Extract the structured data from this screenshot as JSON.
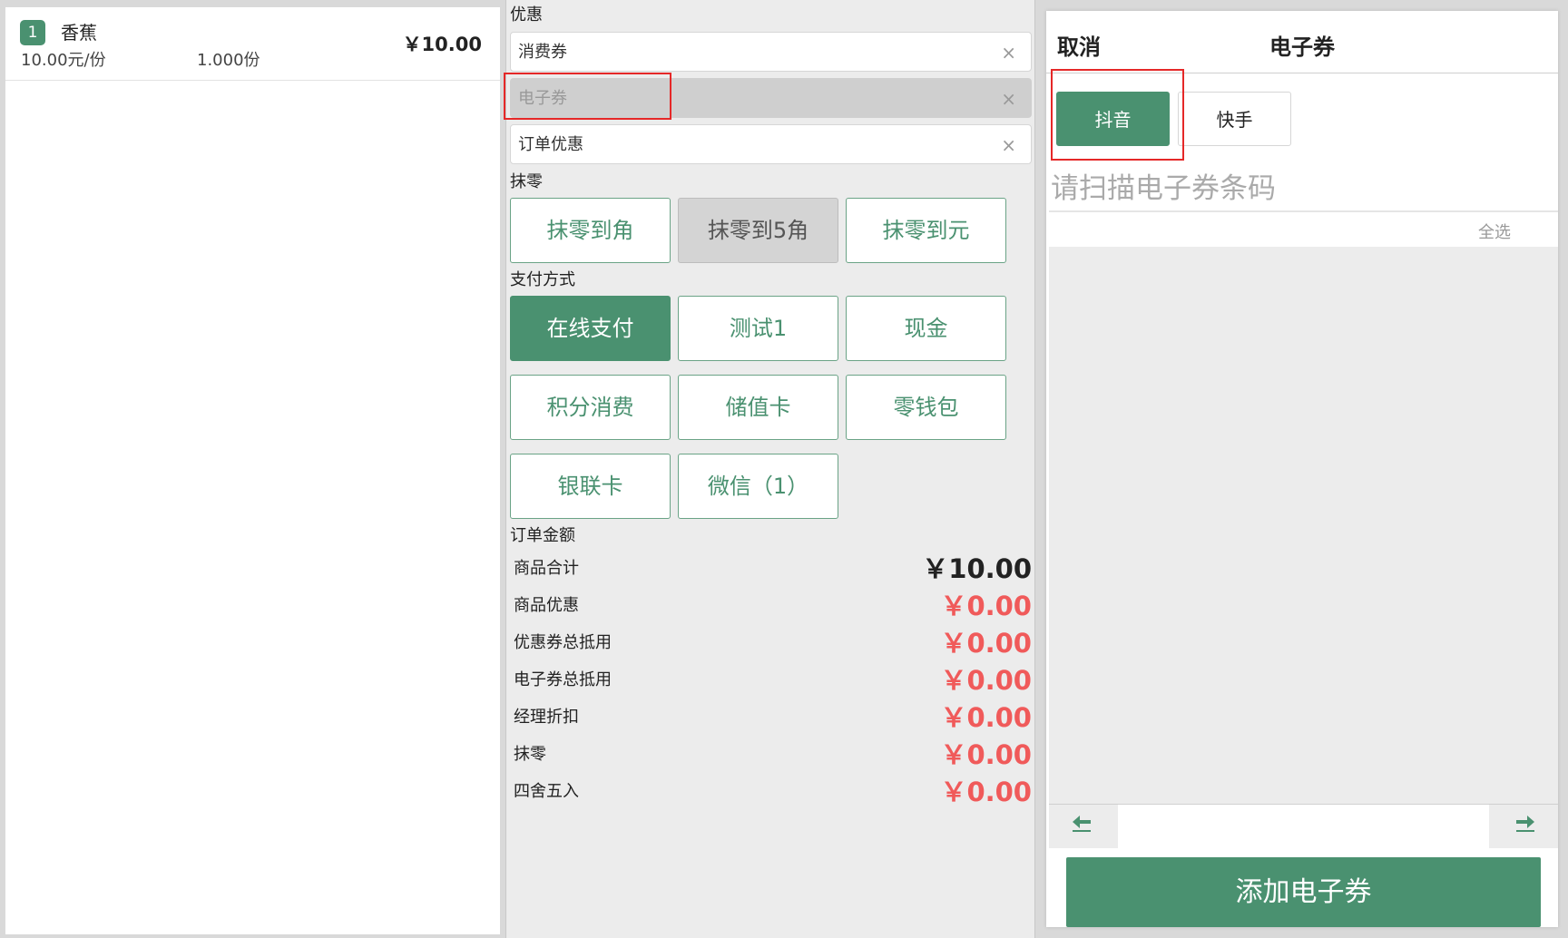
{
  "order": {
    "items": [
      {
        "index": "1",
        "name": "香蕉",
        "unit_price": "10.00元/份",
        "quantity": "1.000份",
        "amount": "￥10.00"
      }
    ]
  },
  "discount": {
    "section_label": "优惠",
    "fields": [
      {
        "label": "消费券",
        "clear": "×",
        "disabled": false
      },
      {
        "label": "电子券",
        "clear": "×",
        "disabled": true
      },
      {
        "label": "订单优惠",
        "clear": "×",
        "disabled": false
      }
    ]
  },
  "rounding": {
    "section_label": "抹零",
    "options": [
      "抹零到角",
      "抹零到5角",
      "抹零到元"
    ],
    "selected": "抹零到5角"
  },
  "payment": {
    "section_label": "支付方式",
    "methods": [
      "在线支付",
      "测试1",
      "现金",
      "积分消费",
      "储值卡",
      "零钱包",
      "银联卡",
      "微信（1）"
    ],
    "selected": "在线支付"
  },
  "summary": {
    "section_label": "订单金额",
    "rows": [
      {
        "label": "商品合计",
        "value": "￥10.00"
      },
      {
        "label": "商品优惠",
        "value": "￥0.00"
      },
      {
        "label": "优惠券总抵用",
        "value": "￥0.00"
      },
      {
        "label": "电子券总抵用",
        "value": "￥0.00"
      },
      {
        "label": "经理折扣",
        "value": "￥0.00"
      },
      {
        "label": "抹零",
        "value": "￥0.00"
      },
      {
        "label": "四舍五入",
        "value": "￥0.00"
      }
    ]
  },
  "ecoupon": {
    "cancel": "取消",
    "title": "电子券",
    "tabs": [
      {
        "label": "抖音",
        "active": true
      },
      {
        "label": "快手",
        "active": false
      }
    ],
    "scan_placeholder": "请扫描电子券条码",
    "select_all": "全选",
    "pager_prev_icon": "arrow-left-icon",
    "pager_next_icon": "arrow-right-icon",
    "add_button": "添加电子券"
  },
  "colors": {
    "accent": "#4a9170",
    "discount_red": "#f05a5a",
    "highlight": "#e52828"
  }
}
